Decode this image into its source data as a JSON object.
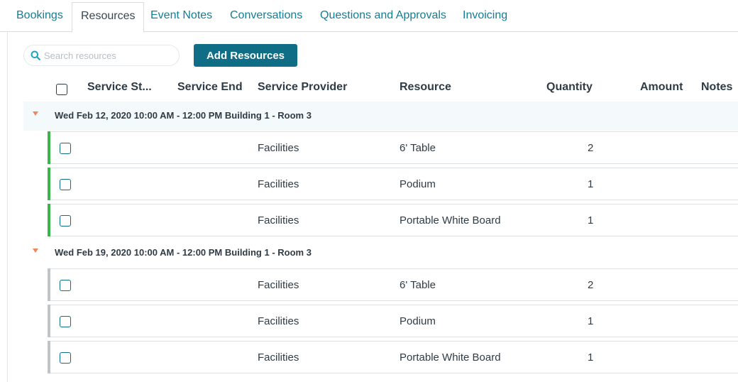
{
  "tabs": [
    {
      "label": "Bookings",
      "active": false
    },
    {
      "label": "Resources",
      "active": true
    },
    {
      "label": "Event Notes",
      "active": false
    },
    {
      "label": "Conversations",
      "active": false
    },
    {
      "label": "Questions and Approvals",
      "active": false
    },
    {
      "label": "Invoicing",
      "active": false
    }
  ],
  "search": {
    "placeholder": "Search resources",
    "value": "",
    "icon": "search-icon"
  },
  "toolbar": {
    "add_label": "Add Resources"
  },
  "columns": {
    "service_start": "Service St...",
    "service_end": "Service End",
    "service_provider": "Service Provider",
    "resource": "Resource",
    "quantity": "Quantity",
    "amount": "Amount",
    "notes": "Notes"
  },
  "groups": [
    {
      "label": "Wed Feb 12, 2020 10:00 AM - 12:00 PM Building 1 - Room 3",
      "rows": [
        {
          "provider": "Facilities",
          "resource": "6' Table",
          "quantity": "2"
        },
        {
          "provider": "Facilities",
          "resource": "Podium",
          "quantity": "1"
        },
        {
          "provider": "Facilities",
          "resource": "Portable White Board",
          "quantity": "1"
        }
      ]
    },
    {
      "label": "Wed Feb 19, 2020 10:00 AM - 12:00 PM Building 1 - Room 3",
      "rows": [
        {
          "provider": "Facilities",
          "resource": "6' Table",
          "quantity": "2"
        },
        {
          "provider": "Facilities",
          "resource": "Podium",
          "quantity": "1"
        },
        {
          "provider": "Facilities",
          "resource": "Portable White Board",
          "quantity": "1"
        }
      ]
    }
  ],
  "colors": {
    "accent": "#0f6e86",
    "tab_link": "#147d96",
    "active_status": "#3ab54a",
    "past_status": "#bfc4c8",
    "group_toggle": "#f0865c"
  }
}
